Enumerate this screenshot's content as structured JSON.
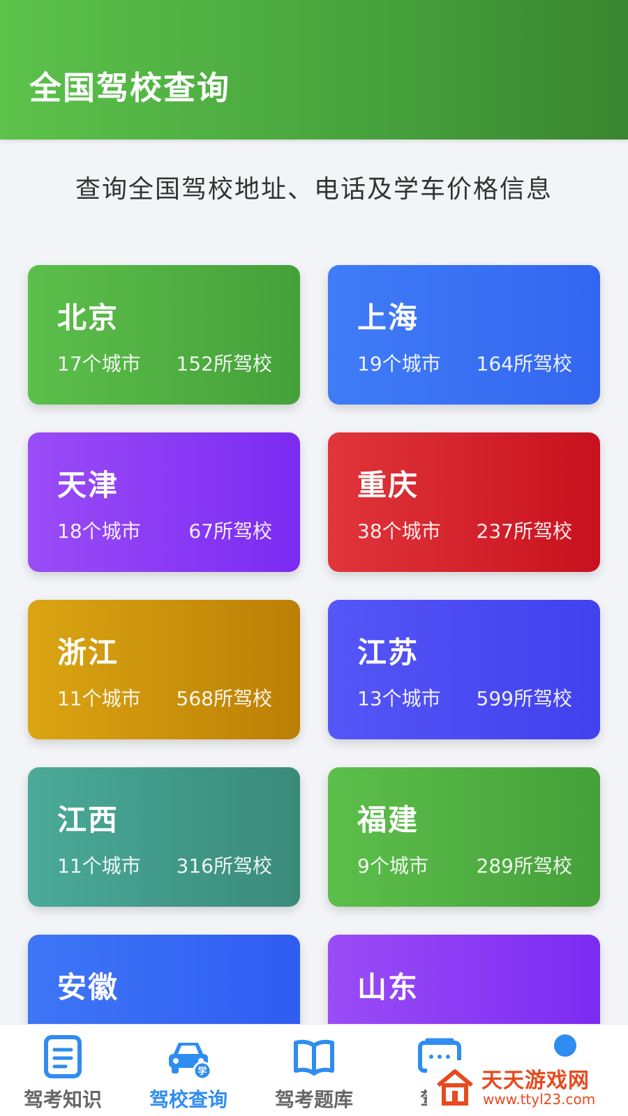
{
  "header": {
    "title": "全国驾校查询"
  },
  "subtitle": "查询全国驾校地址、电话及学车价格信息",
  "provinces": [
    {
      "name": "北京",
      "cities": "17个城市",
      "schools": "152所驾校"
    },
    {
      "name": "上海",
      "cities": "19个城市",
      "schools": "164所驾校"
    },
    {
      "name": "天津",
      "cities": "18个城市",
      "schools": "67所驾校"
    },
    {
      "name": "重庆",
      "cities": "38个城市",
      "schools": "237所驾校"
    },
    {
      "name": "浙江",
      "cities": "11个城市",
      "schools": "568所驾校"
    },
    {
      "name": "江苏",
      "cities": "13个城市",
      "schools": "599所驾校"
    },
    {
      "name": "江西",
      "cities": "11个城市",
      "schools": "316所驾校"
    },
    {
      "name": "福建",
      "cities": "9个城市",
      "schools": "289所驾校"
    },
    {
      "name": "安徽"
    },
    {
      "name": "山东"
    }
  ],
  "tabs": [
    {
      "label": "驾考知识",
      "icon": "document-icon",
      "active": false
    },
    {
      "label": "驾校查询",
      "icon": "car-icon",
      "active": true
    },
    {
      "label": "驾考题库",
      "icon": "book-icon",
      "active": false
    },
    {
      "label": "驾考",
      "icon": "screen-icon",
      "active": false
    },
    {
      "label": "",
      "icon": "user-icon",
      "active": false
    }
  ],
  "car_badge": "学",
  "watermark": {
    "name": "天天游戏网",
    "url": "www.ttyl23.com"
  },
  "colors": {
    "accent": "#2f8cf0",
    "header": "#4caf3f"
  }
}
